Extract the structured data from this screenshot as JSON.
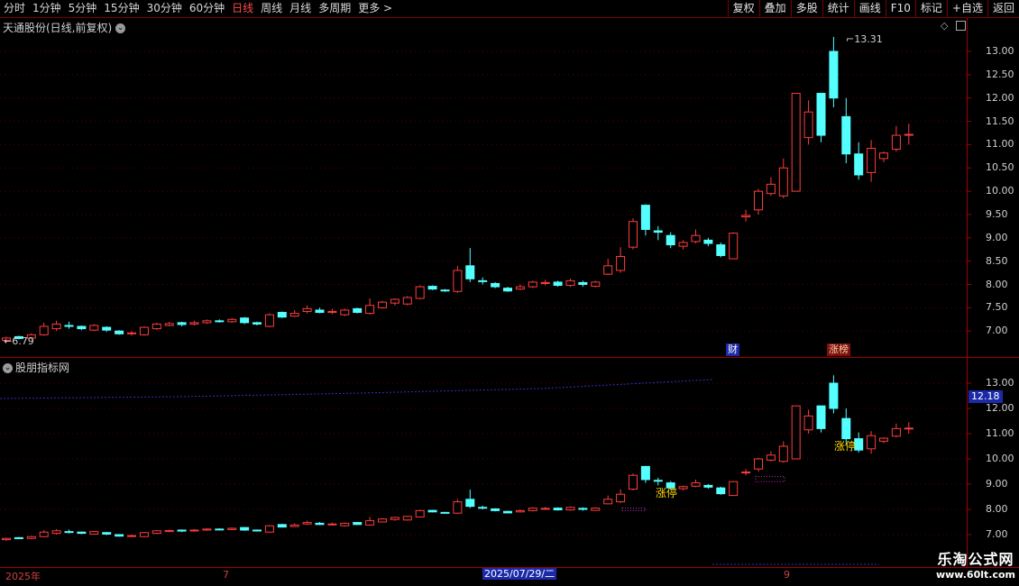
{
  "toolbar": {
    "periods": [
      "分时",
      "1分钟",
      "5分钟",
      "15分钟",
      "30分钟",
      "60分钟",
      "日线",
      "周线",
      "月线",
      "多周期",
      "更多 >"
    ],
    "active_period": "日线",
    "actions": [
      "复权",
      "叠加",
      "多股",
      "统计",
      "画线",
      "F10",
      "标记",
      "+自选",
      "返回"
    ]
  },
  "main_panel": {
    "title": "天通股份(日线,前复权)",
    "high_label": "13.31",
    "low_label": "6.79",
    "y_ticks": [
      "13.00",
      "12.50",
      "12.00",
      "11.50",
      "11.00",
      "10.50",
      "10.00",
      "9.50",
      "9.00",
      "8.50",
      "8.00",
      "7.50",
      "7.00"
    ],
    "markers": {
      "finance": "财",
      "limit_board": "涨榜"
    }
  },
  "sub_panel": {
    "title": "股朋指标网",
    "y_ticks": [
      "13.00",
      "12.00",
      "11.00",
      "10.00",
      "9.00",
      "8.00",
      "7.00"
    ],
    "current_price_badge": "12.18",
    "limit_up_label": "涨停"
  },
  "x_axis": {
    "start_label": "2025年",
    "month7_label": "7",
    "cursor_date": "2025/07/29/二",
    "month9_label": "9"
  },
  "brand": {
    "name": "乐淘公式网",
    "url": "www.60lt.com"
  },
  "colors": {
    "up": "#ff3c3c",
    "down": "#54ffff",
    "grid": "#5a0000",
    "frame": "#a00000",
    "baseline_blue": "#3030c0"
  },
  "chart_data": {
    "type": "candlestick",
    "ylim": [
      6.6,
      13.5
    ],
    "candles": [
      [
        6.8,
        6.85,
        6.75,
        6.88
      ],
      [
        6.88,
        6.84,
        6.82,
        6.9
      ],
      [
        6.85,
        6.92,
        6.82,
        6.95
      ],
      [
        6.92,
        7.1,
        6.9,
        7.18
      ],
      [
        7.05,
        7.15,
        7.0,
        7.22
      ],
      [
        7.12,
        7.1,
        7.05,
        7.2
      ],
      [
        7.1,
        7.05,
        7.02,
        7.12
      ],
      [
        7.02,
        7.12,
        7.0,
        7.15
      ],
      [
        7.08,
        7.02,
        6.98,
        7.1
      ],
      [
        7.0,
        6.94,
        6.92,
        7.02
      ],
      [
        6.95,
        6.96,
        6.9,
        7.0
      ],
      [
        6.92,
        7.08,
        6.9,
        7.1
      ],
      [
        7.05,
        7.15,
        7.02,
        7.18
      ],
      [
        7.12,
        7.16,
        7.1,
        7.2
      ],
      [
        7.18,
        7.14,
        7.1,
        7.2
      ],
      [
        7.15,
        7.18,
        7.12,
        7.22
      ],
      [
        7.18,
        7.22,
        7.15,
        7.25
      ],
      [
        7.22,
        7.2,
        7.18,
        7.25
      ],
      [
        7.2,
        7.25,
        7.18,
        7.28
      ],
      [
        7.28,
        7.18,
        7.15,
        7.3
      ],
      [
        7.18,
        7.15,
        7.12,
        7.2
      ],
      [
        7.1,
        7.35,
        7.08,
        7.38
      ],
      [
        7.4,
        7.3,
        7.28,
        7.42
      ],
      [
        7.32,
        7.38,
        7.3,
        7.45
      ],
      [
        7.42,
        7.48,
        7.38,
        7.55
      ],
      [
        7.45,
        7.4,
        7.38,
        7.5
      ],
      [
        7.4,
        7.42,
        7.36,
        7.48
      ],
      [
        7.35,
        7.45,
        7.32,
        7.48
      ],
      [
        7.48,
        7.4,
        7.38,
        7.5
      ],
      [
        7.38,
        7.55,
        7.35,
        7.7
      ],
      [
        7.5,
        7.62,
        7.48,
        7.65
      ],
      [
        7.6,
        7.68,
        7.55,
        7.7
      ],
      [
        7.58,
        7.72,
        7.55,
        7.75
      ],
      [
        7.7,
        7.95,
        7.68,
        7.98
      ],
      [
        7.96,
        7.9,
        7.88,
        7.98
      ],
      [
        7.88,
        7.86,
        7.84,
        7.9
      ],
      [
        7.85,
        8.3,
        7.82,
        8.4
      ],
      [
        8.4,
        8.12,
        8.05,
        8.78
      ],
      [
        8.08,
        8.06,
        8.0,
        8.15
      ],
      [
        8.02,
        7.95,
        7.92,
        8.05
      ],
      [
        7.92,
        7.86,
        7.84,
        7.95
      ],
      [
        7.9,
        7.95,
        7.88,
        8.0
      ],
      [
        7.95,
        8.05,
        7.92,
        8.08
      ],
      [
        8.02,
        8.04,
        7.98,
        8.1
      ],
      [
        8.05,
        7.98,
        7.95,
        8.08
      ],
      [
        7.98,
        8.08,
        7.95,
        8.12
      ],
      [
        8.04,
        8.0,
        7.95,
        8.08
      ],
      [
        7.96,
        8.05,
        7.94,
        8.08
      ],
      [
        8.22,
        8.4,
        8.2,
        8.55
      ],
      [
        8.3,
        8.6,
        8.25,
        8.8
      ],
      [
        8.8,
        9.35,
        8.75,
        9.42
      ],
      [
        9.7,
        9.18,
        9.05,
        9.72
      ],
      [
        9.15,
        9.12,
        8.95,
        9.25
      ],
      [
        9.05,
        8.85,
        8.78,
        9.12
      ],
      [
        8.82,
        8.9,
        8.75,
        8.95
      ],
      [
        8.92,
        9.05,
        8.88,
        9.18
      ],
      [
        8.95,
        8.88,
        8.82,
        9.0
      ],
      [
        8.85,
        8.62,
        8.58,
        8.9
      ],
      [
        8.55,
        9.1,
        8.55,
        9.12
      ],
      [
        9.45,
        9.48,
        9.35,
        9.6
      ],
      [
        9.6,
        10.0,
        9.5,
        10.05
      ],
      [
        9.95,
        10.15,
        9.9,
        10.3
      ],
      [
        9.9,
        10.5,
        9.85,
        10.7
      ],
      [
        10.0,
        12.1,
        10.0,
        12.1
      ],
      [
        11.15,
        11.7,
        11.0,
        11.95
      ],
      [
        12.1,
        11.2,
        11.05,
        12.1
      ],
      [
        13.0,
        12.0,
        11.8,
        13.31
      ],
      [
        11.6,
        10.8,
        10.6,
        12.0
      ],
      [
        10.8,
        10.35,
        10.25,
        11.05
      ],
      [
        10.4,
        10.92,
        10.2,
        11.1
      ],
      [
        10.7,
        10.82,
        10.62,
        10.85
      ],
      [
        10.9,
        11.2,
        10.85,
        11.4
      ],
      [
        11.2,
        11.22,
        11.0,
        11.45
      ]
    ]
  }
}
